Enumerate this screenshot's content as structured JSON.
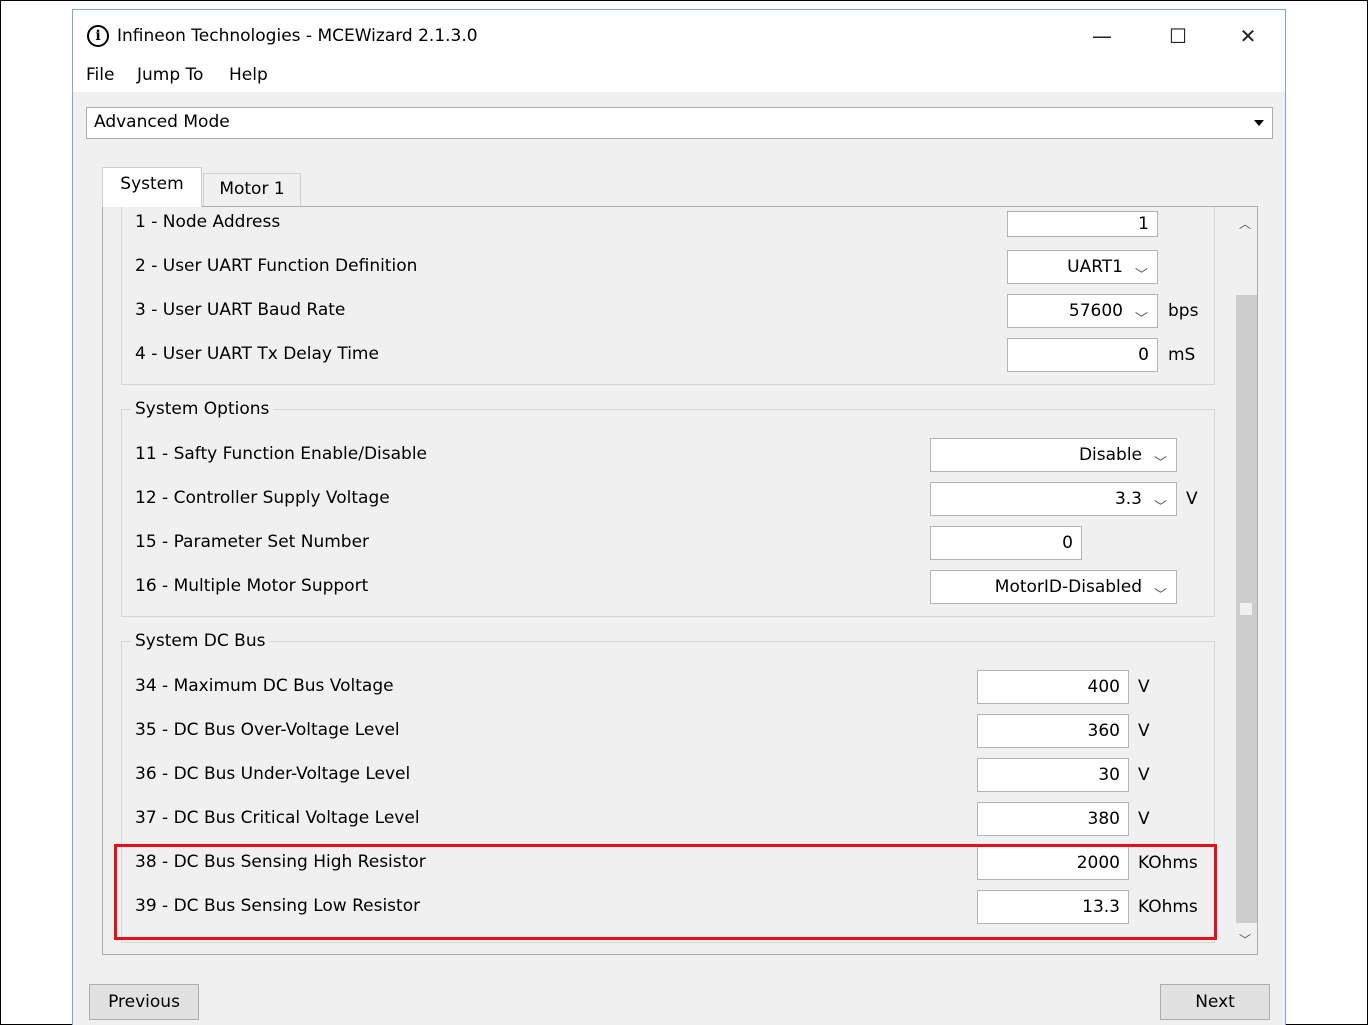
{
  "window": {
    "title": "Infineon Technologies - MCEWizard 2.1.3.0",
    "icon": "infineon-logo-icon",
    "controls": {
      "minimize": "—",
      "maximize": "☐",
      "close": "✕"
    }
  },
  "menu": {
    "items": [
      "File",
      "Jump To",
      "Help"
    ]
  },
  "mode_select": {
    "value": "Advanced Mode"
  },
  "tabs": [
    {
      "label": "System",
      "active": true
    },
    {
      "label": "Motor 1",
      "active": false
    }
  ],
  "uart_rows": [
    {
      "label": "1 - Node Address",
      "value": "1",
      "unit": ""
    },
    {
      "label": "2 - User UART Function Definition",
      "value": "UART1",
      "unit": ""
    },
    {
      "label": "3 - User UART Baud Rate",
      "value": "57600",
      "unit": "bps"
    },
    {
      "label": "4 - User UART Tx Delay Time",
      "value": "0",
      "unit": "mS"
    }
  ],
  "system_options": {
    "title": "System Options",
    "rows": [
      {
        "label": "11 - Safty Function Enable/Disable",
        "value": "Disable",
        "unit": ""
      },
      {
        "label": "12 - Controller Supply Voltage",
        "value": "3.3",
        "unit": "V"
      },
      {
        "label": "15 - Parameter Set Number",
        "value": "0",
        "unit": ""
      },
      {
        "label": "16 - Multiple Motor Support",
        "value": "MotorID-Disabled",
        "unit": ""
      }
    ]
  },
  "system_dc_bus": {
    "title": "System DC Bus",
    "rows": [
      {
        "label": "34 - Maximum DC Bus Voltage",
        "value": "400",
        "unit": "V"
      },
      {
        "label": "35 - DC Bus Over-Voltage Level",
        "value": "360",
        "unit": "V"
      },
      {
        "label": "36 - DC Bus Under-Voltage Level",
        "value": "30",
        "unit": "V"
      },
      {
        "label": "37 - DC Bus Critical Voltage Level",
        "value": "380",
        "unit": "V"
      },
      {
        "label": "38 - DC Bus Sensing High Resistor",
        "value": "2000",
        "unit": "KOhms"
      },
      {
        "label": "39 - DC Bus Sensing Low Resistor",
        "value": "13.3",
        "unit": "KOhms"
      }
    ]
  },
  "buttons": {
    "previous": "Previous",
    "next": "Next"
  },
  "colors": {
    "highlight": "#e3101c",
    "window_bg": "#f0f0f0"
  }
}
